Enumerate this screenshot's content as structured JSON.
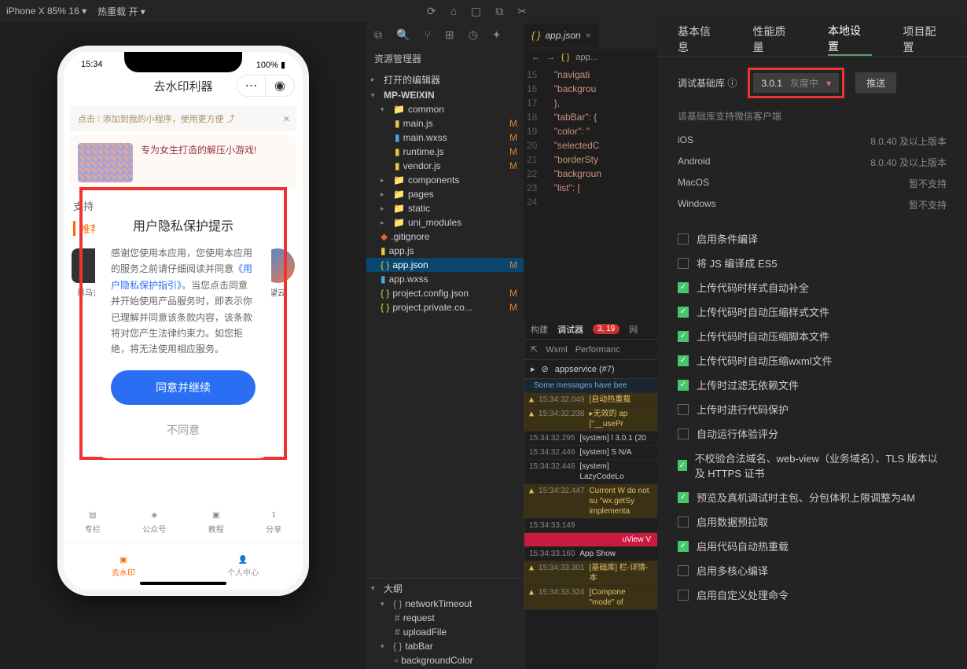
{
  "topbar": {
    "device": "iPhone X 85% 16",
    "reload": "热重载 开"
  },
  "sim": {
    "time": "15:34",
    "battery": "100%",
    "appTitle": "去水印利器",
    "bannerText": "点击 ⁝ 添加到我的小程序，使用更方便 ⤴",
    "cardText": "专为女生打造的解压小游戏!",
    "recLbl": "推荐",
    "catLbl": "支持",
    "appIcon": "黑马去",
    "nav": {
      "a": "专栏",
      "b": "公众号",
      "c": "教程",
      "d": "分享"
    },
    "tabbar": {
      "a": "去水印",
      "b": "个人中心"
    },
    "modal": {
      "title": "用户隐私保护提示",
      "body_a": "感谢您使用本应用，您使用本应用的服务之前请仔细阅读并同意",
      "link": "《用户隐私保护指引》",
      "body_b": "。当您点击同意并开始使用产品服务时，即表示你已理解并同意该条款内容，该条款将对您产生法律约束力。如您拒绝，将无法使用相应服务。",
      "agree": "同意并继续",
      "reject": "不同意"
    }
  },
  "explorer": {
    "title": "资源管理器",
    "openEditors": "打开的编辑器",
    "root": "MP-WEIXIN",
    "files": {
      "common": "common",
      "main_js": "main.js",
      "main_wxss": "main.wxss",
      "runtime_js": "runtime.js",
      "vendor_js": "vendor.js",
      "components": "components",
      "pages": "pages",
      "static": "static",
      "uni_modules": "uni_modules",
      "gitignore": ".gitignore",
      "app_js": "app.js",
      "app_json": "app.json",
      "app_wxss": "app.wxss",
      "project_config": "project.config.json",
      "project_private": "project.private.co..."
    },
    "mStatus": "M",
    "outline": "大纲",
    "o_net": "networkTimeout",
    "o_req": "request",
    "o_upl": "uploadFile",
    "o_tab": "tabBar",
    "o_bg": "backgroundColor"
  },
  "editor": {
    "filename": "app.json",
    "crumb_file": "app...",
    "lines": [
      "\"navigati",
      "\"backgrou",
      "},",
      "\"tabBar\": {",
      "\"color\": \"",
      "\"selectedC",
      "\"borderSty",
      "\"backgroun",
      "\"list\": ["
    ]
  },
  "debugger": {
    "build": "构建",
    "tab": "调试器",
    "badge": "3, 19",
    "net": "网",
    "wxml": "Wxml",
    "perf": "Performanc",
    "svc": "appservice (#7)",
    "logs": [
      {
        "t": "info",
        "ts": "",
        "txt": "Some messages have bee"
      },
      {
        "t": "warn",
        "ts": "15:34:32.049",
        "txt": "[自动热重载"
      },
      {
        "t": "warn",
        "ts": "15:34:32.238",
        "txt": "▸无效的 ap  [\"__usePr"
      },
      {
        "t": "",
        "ts": "15:34:32.295",
        "txt": "[system] l 3.0.1 (20"
      },
      {
        "t": "",
        "ts": "15:34:32.446",
        "txt": "[system] S N/A"
      },
      {
        "t": "",
        "ts": "15:34:32.446",
        "txt": "[system] LazyCodeLo"
      },
      {
        "t": "warn",
        "ts": "15:34:32.447",
        "txt": "Current W do not su \"wx.getSy implementa"
      },
      {
        "t": "",
        "ts": "15:34:33.149",
        "txt": ""
      },
      {
        "t": "uview",
        "ts": "",
        "txt": "uView V"
      },
      {
        "t": "",
        "ts": "15:34:33.160",
        "txt": "App Show"
      },
      {
        "t": "warn",
        "ts": "15:34:33.301",
        "txt": "[基础库] 栏-详情-本"
      },
      {
        "t": "warn",
        "ts": "15:34:33.324",
        "txt": "[Compone \"mode\" of"
      }
    ]
  },
  "settings": {
    "tabs": {
      "basic": "基本信息",
      "perf": "性能质量",
      "local": "本地设置",
      "proj": "项目配置"
    },
    "libLabel": "调试基础库 ⓘ",
    "version": "3.0.1",
    "gray": "灰度中",
    "push": "推送",
    "supportTxt": "该基础库支持微信客户端",
    "os": {
      "ios": "iOS",
      "ios_v": "8.0.40 及以上版本",
      "and": "Android",
      "and_v": "8.0.40 及以上版本",
      "mac": "MacOS",
      "mac_v": "暂不支持",
      "win": "Windows",
      "win_v": "暂不支持"
    },
    "checks": [
      {
        "on": false,
        "label": "启用条件编译"
      },
      {
        "on": false,
        "label": "将 JS 编译成 ES5"
      },
      {
        "on": true,
        "label": "上传代码时样式自动补全"
      },
      {
        "on": true,
        "label": "上传代码时自动压缩样式文件"
      },
      {
        "on": true,
        "label": "上传代码时自动压缩脚本文件"
      },
      {
        "on": true,
        "label": "上传代码时自动压缩wxml文件"
      },
      {
        "on": true,
        "label": "上传时过滤无依赖文件"
      },
      {
        "on": false,
        "label": "上传时进行代码保护"
      },
      {
        "on": false,
        "label": "自动运行体验评分"
      },
      {
        "on": true,
        "label": "不校验合法域名、web-view（业务域名）、TLS 版本以及 HTTPS 证书"
      },
      {
        "on": true,
        "label": "预览及真机调试时主包、分包体积上限调整为4M"
      },
      {
        "on": false,
        "label": "启用数据预拉取"
      },
      {
        "on": true,
        "label": "启用代码自动热重载"
      },
      {
        "on": false,
        "label": "启用多核心编译"
      },
      {
        "on": false,
        "label": "启用自定义处理命令"
      }
    ]
  }
}
